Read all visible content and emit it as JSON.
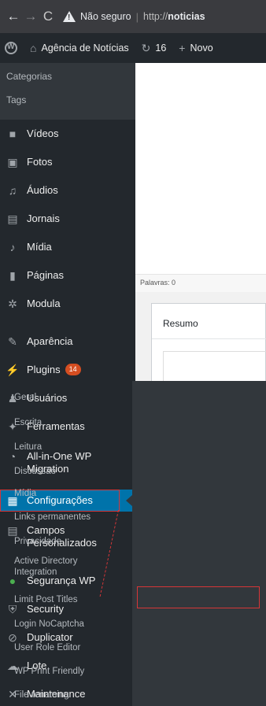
{
  "browser": {
    "security_label": "Não seguro",
    "url_scheme": "http://",
    "url_host": "noticias"
  },
  "admin_bar": {
    "site_name": "Agência de Notícias",
    "updates_count": "16",
    "new_label": "Novo"
  },
  "sidebar": {
    "top_submenu": [
      "Categorias",
      "Tags"
    ],
    "items": [
      {
        "label": "Vídeos",
        "icon": "video-icon"
      },
      {
        "label": "Fotos",
        "icon": "photo-icon"
      },
      {
        "label": "Áudios",
        "icon": "music-icon"
      },
      {
        "label": "Jornais",
        "icon": "newspaper-icon"
      },
      {
        "label": "Mídia",
        "icon": "media-icon"
      },
      {
        "label": "Páginas",
        "icon": "pages-icon"
      },
      {
        "label": "Modula",
        "icon": "modula-icon"
      },
      {
        "label": "Aparência",
        "icon": "appearance-icon"
      },
      {
        "label": "Plugins",
        "icon": "plugin-icon",
        "badge": "14"
      },
      {
        "label": "Usuários",
        "icon": "users-icon"
      },
      {
        "label": "Ferramentas",
        "icon": "tools-icon"
      },
      {
        "label": "All-in-One WP Migration",
        "icon": "migration-icon"
      },
      {
        "label": "Configurações",
        "icon": "settings-icon"
      },
      {
        "label": "Campos Personalizados",
        "icon": "custom-fields-icon"
      },
      {
        "label": "Segurança WP",
        "icon": "security-wp-icon"
      },
      {
        "label": "Security",
        "icon": "shield-icon"
      },
      {
        "label": "Duplicator",
        "icon": "duplicator-icon"
      },
      {
        "label": "Lote",
        "icon": "lote-icon"
      },
      {
        "label": "Maintenance",
        "icon": "maintenance-icon"
      }
    ]
  },
  "content": {
    "word_count": "Palavras: 0",
    "summary_title": "Resumo"
  },
  "settings_submenu": [
    "Geral",
    "Escrita",
    "Leitura",
    "Discussão",
    "Mídia",
    "Links permanentes",
    "Privacidade",
    "Active Directory Integration",
    "Limit Post Titles",
    "Login NoCaptcha",
    "User Role Editor",
    "WP Print Friendly",
    "File renaming"
  ],
  "colors": {
    "menu_bg": "#23282d",
    "submenu_bg": "#32373c",
    "active_bg": "#0073aa",
    "highlight_outline": "#d63638",
    "badge": "#d54e21"
  }
}
